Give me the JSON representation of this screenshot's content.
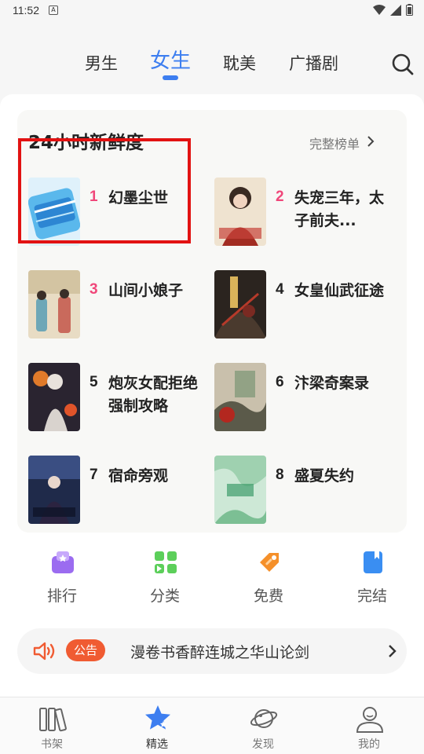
{
  "status_bar": {
    "time": "11:52"
  },
  "tabs": [
    {
      "label": "男生",
      "active": false
    },
    {
      "label": "女生",
      "active": true
    },
    {
      "label": "耽美",
      "active": false
    },
    {
      "label": "广播剧",
      "active": false
    }
  ],
  "ranking": {
    "title": "24小时新鲜度",
    "more_label": "完整榜单",
    "items": [
      {
        "rank": "1",
        "title": "幻墨尘世"
      },
      {
        "rank": "2",
        "title": "失宠三年，太子前夫..."
      },
      {
        "rank": "3",
        "title": "山间小娘子"
      },
      {
        "rank": "4",
        "title": "女皇仙武征途"
      },
      {
        "rank": "5",
        "title": "炮灰女配拒绝强制攻略"
      },
      {
        "rank": "6",
        "title": "汴梁奇案录"
      },
      {
        "rank": "7",
        "title": "宿命旁观"
      },
      {
        "rank": "8",
        "title": "盛夏失约"
      }
    ]
  },
  "shortcuts": [
    {
      "label": "排行",
      "icon": "ranking-icon"
    },
    {
      "label": "分类",
      "icon": "category-icon"
    },
    {
      "label": "免费",
      "icon": "free-tag-icon"
    },
    {
      "label": "完结",
      "icon": "finished-book-icon"
    }
  ],
  "notice": {
    "badge": "公告",
    "text": "漫卷书香醉连城之华山论剑"
  },
  "bottom_nav": [
    {
      "label": "书架",
      "active": false
    },
    {
      "label": "精选",
      "active": true
    },
    {
      "label": "发现",
      "active": false
    },
    {
      "label": "我的",
      "active": false
    }
  ],
  "colors": {
    "accent": "#3d7ef0",
    "rank_top": "#f0477a",
    "notice_badge": "#f05b32",
    "highlight": "#e21212"
  }
}
